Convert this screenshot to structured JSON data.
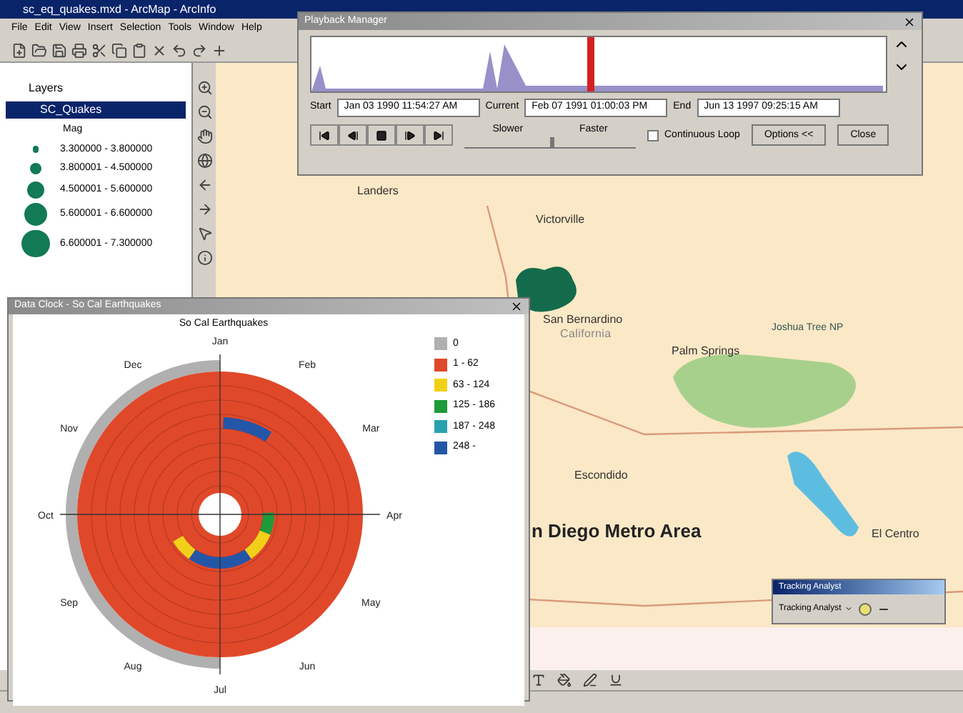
{
  "window": {
    "title": "sc_eq_quakes.mxd - ArcMap - ArcInfo"
  },
  "menu": [
    "File",
    "Edit",
    "View",
    "Insert",
    "Selection",
    "Tools",
    "Window",
    "Help"
  ],
  "toc": {
    "root": "Layers",
    "layer": {
      "name": "SC_Quakes",
      "selected": true
    },
    "field": "Mag",
    "classes": [
      "3.300000 - 3.800000",
      "3.800001 - 4.500000",
      "4.500001 - 5.600000",
      "5.600001 - 6.600000",
      "6.600001 - 7.300000"
    ]
  },
  "map": {
    "labels": [
      {
        "text": "Landers",
        "kind": "town"
      },
      {
        "text": "Victorville",
        "kind": "town"
      },
      {
        "text": "San Bernardino",
        "kind": "town"
      },
      {
        "text": "California",
        "kind": "region"
      },
      {
        "text": "Palm Springs",
        "kind": "town"
      },
      {
        "text": "Joshua Tree NP",
        "kind": "park"
      },
      {
        "text": "Escondido",
        "kind": "town"
      },
      {
        "text": "El Centro",
        "kind": "town"
      },
      {
        "text": "n Diego Metro Area",
        "kind": "metro"
      }
    ]
  },
  "playback": {
    "title": "Playback Manager",
    "timeline": {
      "level": 0.48
    },
    "start_label": "Start",
    "start": "Jan 03 1990 11:54:27 AM",
    "current_label": "Current",
    "current": "Feb 07 1991 01:00:03 PM",
    "end_label": "End",
    "end": "Jun 13 1997 09:25:15 AM",
    "slower": "Slower",
    "faster": "Faster",
    "speed": {
      "level": 0.5
    },
    "loop": {
      "label": "Continuous Loop",
      "checked": false
    },
    "buttons": [
      "Options <<",
      "Close"
    ]
  },
  "chart_window": {
    "title": "Data Clock - So Cal Earthquakes",
    "chart_title": "So Cal Earthquakes",
    "months": [
      "Jan",
      "Feb",
      "Mar",
      "Apr",
      "May",
      "Jun",
      "Jul",
      "Aug",
      "Sep",
      "Oct",
      "Nov",
      "Dec"
    ],
    "legend": [
      {
        "label": "0",
        "color": "#b0b0b0"
      },
      {
        "label": "1 - 62",
        "color": "#e0482a"
      },
      {
        "label": "63 - 124",
        "color": "#f2d01a"
      },
      {
        "label": "125 - 186",
        "color": "#1e9a3a"
      },
      {
        "label": "187 - 248",
        "color": "#2aa0b0"
      },
      {
        "label": "248 -",
        "color": "#2456a8"
      }
    ]
  },
  "tracking": {
    "title": "Tracking Analyst",
    "dropdown": "Tracking Analyst"
  }
}
